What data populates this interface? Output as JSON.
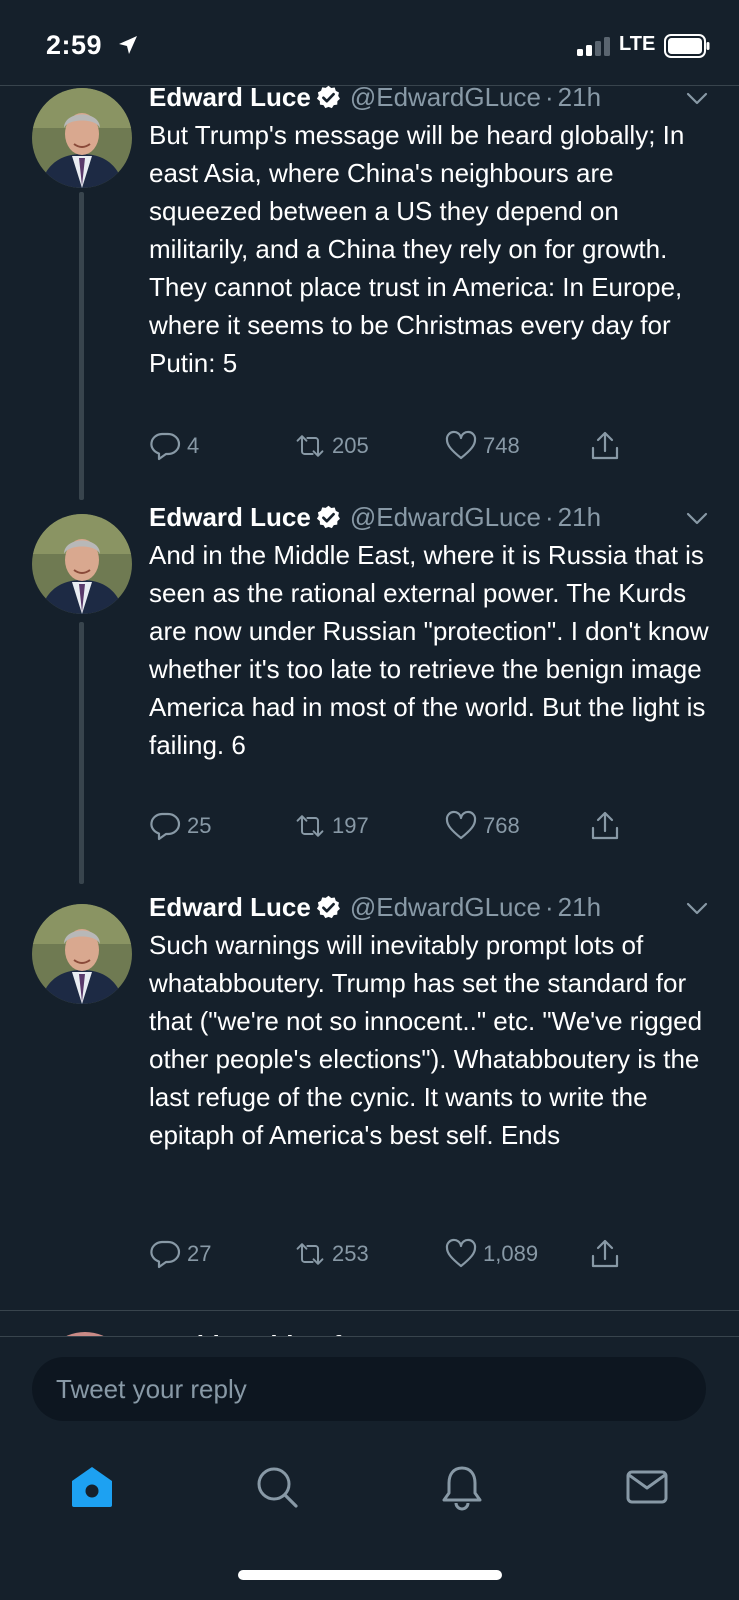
{
  "status_bar": {
    "time": "2:59",
    "network": "LTE"
  },
  "tweets": [
    {
      "author": "Edward Luce",
      "handle": "@EdwardGLuce",
      "separator": "·",
      "time": "21h",
      "text": "But Trump's message will be heard globally; In east Asia, where China's neighbours are squeezed between a US they depend on militarily, and a China they rely on for growth. They cannot place trust in America: In Europe, where it seems to be Christmas every day for Putin: 5",
      "replies": "4",
      "retweets": "205",
      "likes": "748"
    },
    {
      "author": "Edward Luce",
      "handle": "@EdwardGLuce",
      "separator": "·",
      "time": "21h",
      "text": "And in the Middle East, where it is Russia that is seen as the rational external power. The Kurds are now under Russian \"protection\". I don't know whether it's too late to retrieve the benign image America had in most of the world. But the light is failing. 6",
      "replies": "25",
      "retweets": "197",
      "likes": "768"
    },
    {
      "author": "Edward Luce",
      "handle": "@EdwardGLuce",
      "separator": "·",
      "time": "21h",
      "text": "Such warnings will inevitably prompt lots of whatabboutery. Trump has set the standard for that (\"we're not so innocent..\" etc. \"We've rigged other people's elections\"). Whatabboutery is the last refuge of the cynic. It wants to write the epitaph of America's best self. Ends",
      "replies": "27",
      "retweets": "253",
      "likes": "1,089"
    }
  ],
  "partial_tweet": {
    "author": "David Rothkopf"
  },
  "reply_box": {
    "placeholder": "Tweet your reply"
  },
  "tab_bar": {
    "items": [
      {
        "icon": "home-icon",
        "active": true
      },
      {
        "icon": "search-icon",
        "active": false
      },
      {
        "icon": "bell-icon",
        "active": false
      },
      {
        "icon": "mail-icon",
        "active": false
      }
    ]
  },
  "colors": {
    "background": "#15202b",
    "secondary_text": "#8899a6",
    "accent": "#1da1f2",
    "divider": "#38444d"
  }
}
